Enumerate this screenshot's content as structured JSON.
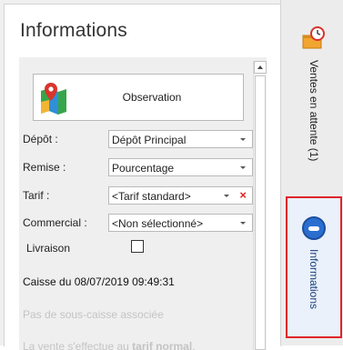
{
  "panel": {
    "title": "Informations",
    "observation_button": {
      "label": "Observation",
      "icon": "map-icon"
    }
  },
  "form": {
    "depot": {
      "label": "Dépôt :",
      "value": "Dépôt Principal"
    },
    "remise": {
      "label": "Remise :",
      "value": "Pourcentage"
    },
    "tarif": {
      "label": "Tarif :",
      "value": "<Tarif standard>",
      "clear_symbol": "×"
    },
    "commercial": {
      "label": "Commercial :",
      "value": "<Non sélectionné>"
    },
    "livraison": {
      "label": "Livraison",
      "checked": false
    }
  },
  "caisse": {
    "text": "Caisse  du 08/07/2019 09:49:31"
  },
  "notes": {
    "sous_caisse": "Pas de sous-caisse associée",
    "tarif_prefix": "La vente s'effectue au ",
    "tarif_bold": "tarif normal",
    "tarif_suffix": "."
  },
  "side_tabs": {
    "pending": {
      "label": "Ventes en attente (1)",
      "icon": "pending-sales-icon"
    },
    "info": {
      "label": "Informations",
      "icon": "info-icon",
      "active": true
    }
  },
  "colors": {
    "highlight_border": "#e0242b",
    "info_blue": "#2a6fd0",
    "clear_red": "#e02020"
  }
}
